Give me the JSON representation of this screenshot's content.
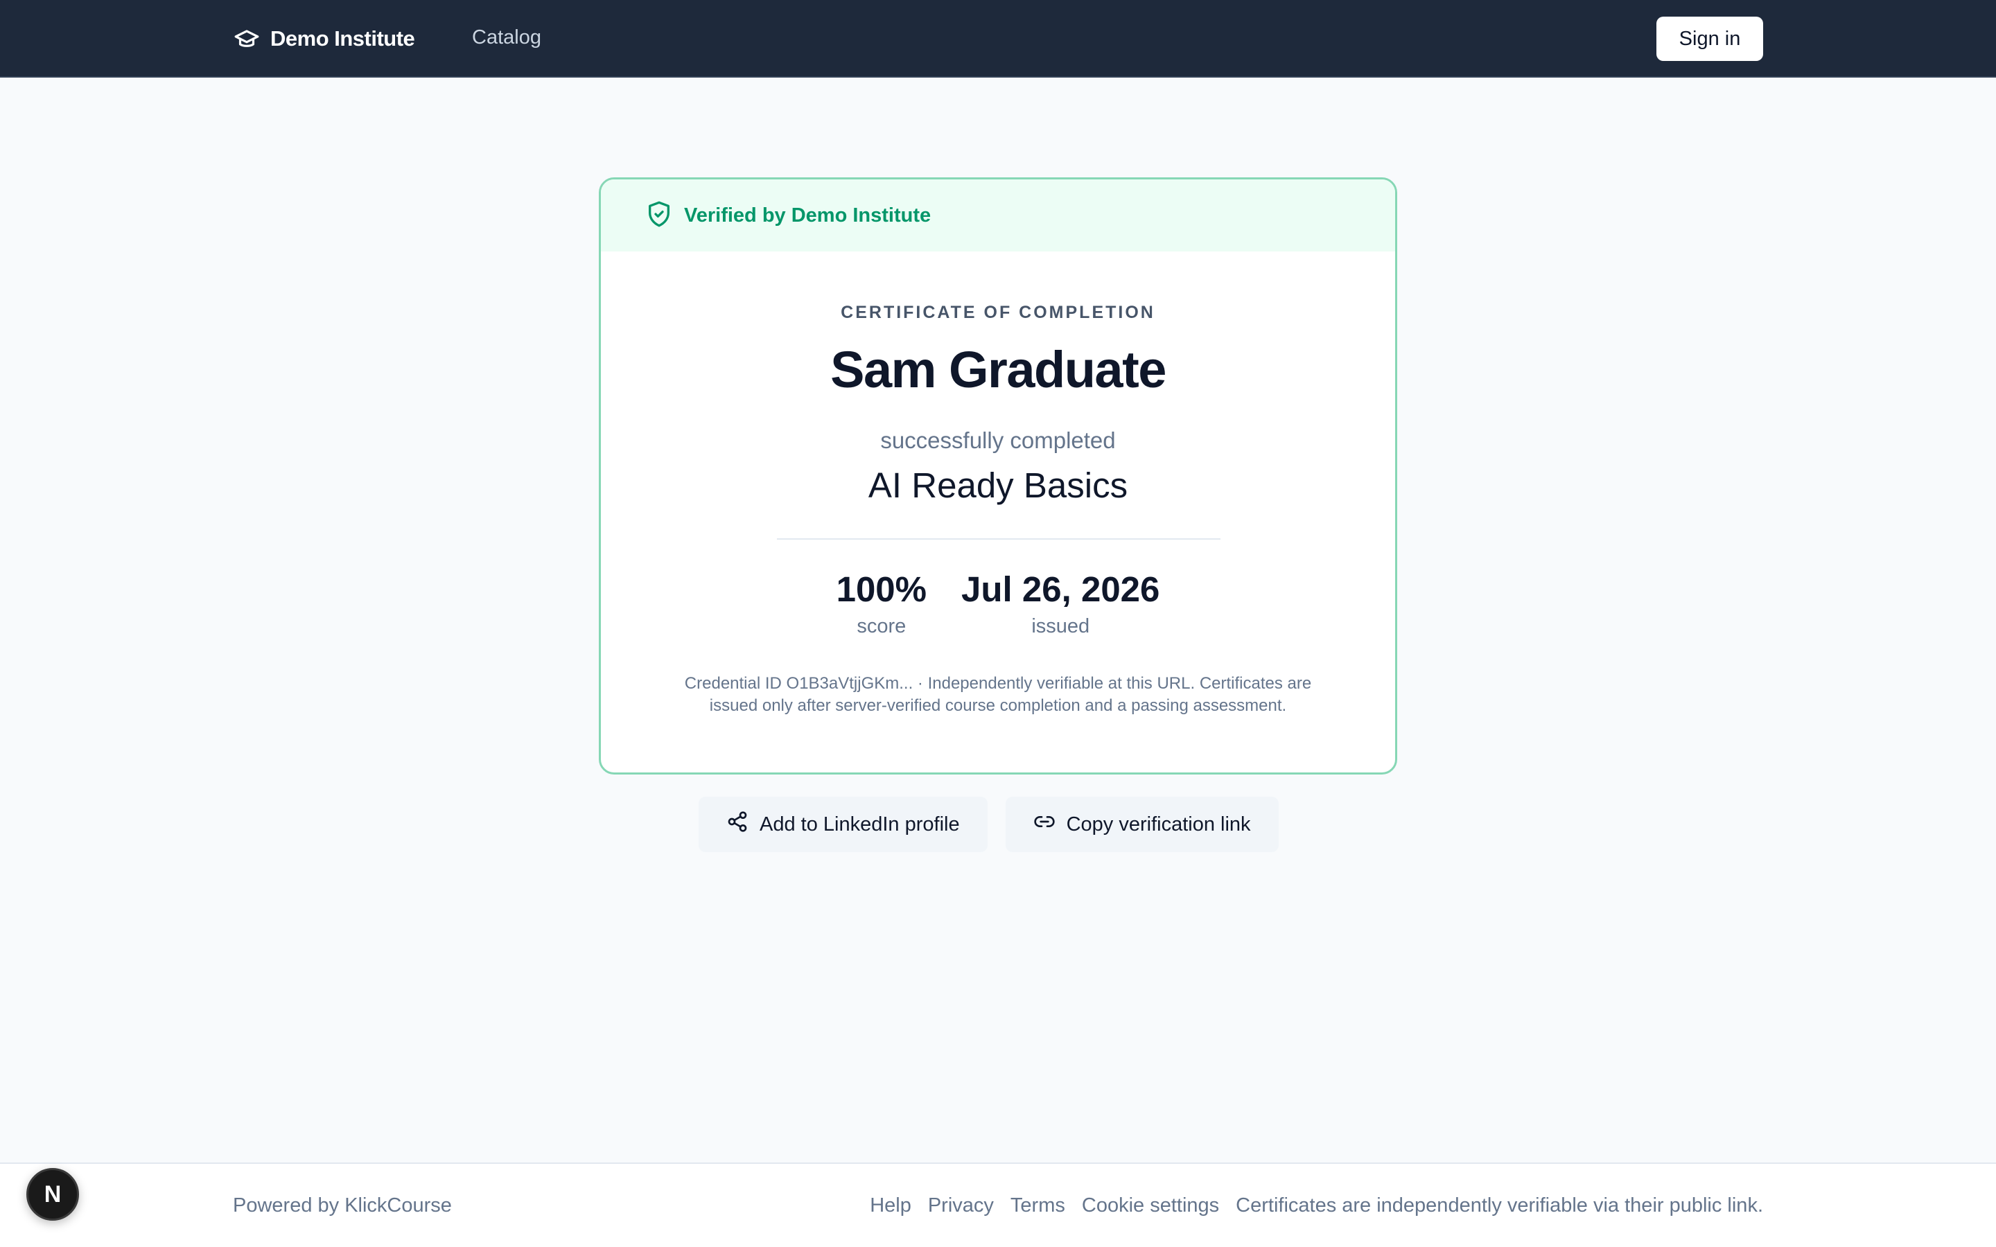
{
  "header": {
    "brand_name": "Demo Institute",
    "brand_icon": "graduation-cap-icon",
    "nav_catalog": "Catalog",
    "signin_label": "Sign in"
  },
  "certificate": {
    "verified_text": "Verified by Demo Institute",
    "verified_icon": "shield-check-icon",
    "label": "CERTIFICATE OF COMPLETION",
    "recipient": "Sam Graduate",
    "completed_text": "successfully completed",
    "course": "AI Ready Basics",
    "score_value": "100%",
    "score_label": "score",
    "issued_value": "Jul 26, 2026",
    "issued_label": "issued",
    "fineprint": "Credential ID O1B3aVtjjGKm... · Independently verifiable at this URL. Certificates are issued only after server-verified course completion and a passing assessment."
  },
  "actions": {
    "linkedin_label": "Add to LinkedIn profile",
    "linkedin_icon": "share-icon",
    "copy_label": "Copy verification link",
    "copy_icon": "link-icon"
  },
  "footer": {
    "powered": "Powered by KlickCourse",
    "links": [
      "Help",
      "Privacy",
      "Terms",
      "Cookie settings"
    ],
    "note": "Certificates are independently verifiable via their public link."
  },
  "dev_badge": {
    "letter": "N"
  },
  "colors": {
    "header_bg": "#1e293b",
    "accent_green": "#059669",
    "banner_bg": "#ecfdf5",
    "card_border": "#86d7b5"
  }
}
